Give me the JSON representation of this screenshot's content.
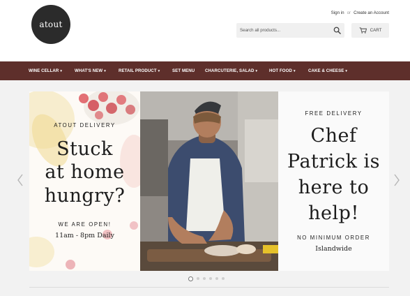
{
  "header": {
    "logo_text": "atout",
    "sign_in": "Sign in",
    "or": "or",
    "create_account": "Create an Account",
    "search_placeholder": "Search all products...",
    "cart_label": "CART"
  },
  "nav": {
    "items": [
      {
        "label": "WINE CELLAR",
        "dropdown": true
      },
      {
        "label": "WHAT'S NEW",
        "dropdown": true
      },
      {
        "label": "RETAIL PRODUCT",
        "dropdown": true
      },
      {
        "label": "SET MENU",
        "dropdown": false
      },
      {
        "label": "CHARCUTERIE, SALAD",
        "dropdown": true
      },
      {
        "label": "HOT FOOD",
        "dropdown": true
      },
      {
        "label": "CAKE & CHEESE",
        "dropdown": true
      }
    ]
  },
  "slide": {
    "left": {
      "eyebrow": "ATOUT DELIVERY",
      "headline_1": "Stuck",
      "headline_2": "at home",
      "headline_3": "hungry?",
      "open_label": "WE ARE OPEN!",
      "hours": "11am - 8pm Daily"
    },
    "right": {
      "eyebrow": "FREE DELIVERY",
      "headline_1": "Chef",
      "headline_2": "Patrick is",
      "headline_3": "here to",
      "headline_4": "help!",
      "min_order": "NO MINIMUM ORDER",
      "area": "Islandwide"
    }
  },
  "carousel": {
    "slide_count": 6,
    "active_index": 0
  },
  "colors": {
    "nav_bg": "#5e2f2b",
    "logo_bg": "#2b2b2b",
    "page_bg": "#f2f2f2"
  },
  "icons": {
    "search": "magnifier",
    "cart": "shopping-cart",
    "prev": "chevron-left",
    "next": "chevron-right"
  }
}
